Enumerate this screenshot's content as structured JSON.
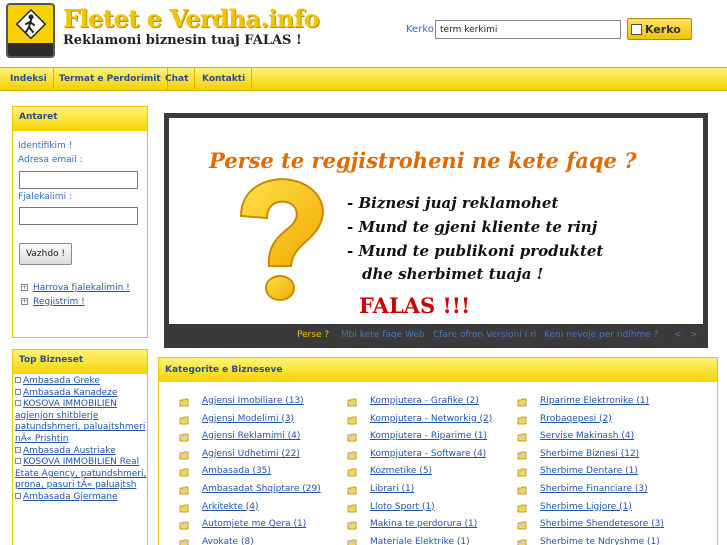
{
  "header": {
    "site_title": "Fletet e Verdha.info",
    "slogan": "Reklamoni biznesin tuaj FALAS !",
    "search_label": "Kerko",
    "search_value": "term kerkimi",
    "search_button": "Kerko"
  },
  "nav": {
    "items": [
      "Indeksi",
      "Termat e Perdorimit",
      "Chat",
      "Kontakti"
    ]
  },
  "members": {
    "title": "Antaret",
    "login_label": "Identifikim !",
    "email_label": "Adresa email :",
    "password_label": "Fjalekalimi :",
    "submit": "Vazhdo !",
    "forgot_link": "Harrova fjalekalimin !",
    "register_link": "Regjistrim !"
  },
  "top_business": {
    "title": "Top Bizneset",
    "items": [
      "Ambasada Greke",
      "Ambasada Kanadeze",
      "KOSOVA IMMOBILIEN agjenjon shitblerje patundshmeri, paluajtshmeri nÃ« Prishtin",
      "Ambasada Austriake",
      "KOSOVA IMMOBILIEN Real Etate Agency, patundshmeri, prona, pasuri tÃ« paluajtsh",
      "Ambasada Gjermane"
    ]
  },
  "banner": {
    "title": "Perse te regjistroheni ne kete faqe ?",
    "lines": [
      "- Biznesi juaj reklamohet",
      "- Mund te gjeni kliente te rinj",
      "- Mund te publikoni produktet",
      "dhe sherbimet tuaja !"
    ],
    "falas": "FALAS !!!",
    "tabs": [
      "Perse ?",
      "Mbi kete faqe Web",
      "Cfare ofron Versioni I ri",
      "Keni nevoje per ndihme ?"
    ],
    "prev": "<",
    "next": ">"
  },
  "categories": {
    "title": "Kategorite e Bizneseve",
    "col1": [
      "Agjensi Imobiliare (13)",
      "Agjensi Modelimi (3)",
      "Agjensi Reklamimi (4)",
      "Agjensi Udhetimi (22)",
      "Ambasada (35)",
      "Ambasadat Shqiptare (29)",
      "Arkitekte (4)",
      "Automjete me Qera (1)",
      "Avokate (8)"
    ],
    "col2": [
      "Kompjutera - Grafike (2)",
      "Kompjutera - Networkig (2)",
      "Kompjutera - Riparime (1)",
      "Kompjutera - Software (4)",
      "Kozmetike (5)",
      "Librari (1)",
      "Lloto Sport (1)",
      "Makina te perdorura (1)",
      "Materiale Elektrike (1)"
    ],
    "col3": [
      "Riparime Elektronike (1)",
      "Rrobaqepesi (2)",
      "Servise Makinash (4)",
      "Sherbime Biznesi (12)",
      "Sherbime Dentare (1)",
      "Sherbime Financiare (3)",
      "Sherbime Ligjore (1)",
      "Sherbime Shendetesore (3)",
      "Sherbime te Ndryshme (1)"
    ]
  },
  "colors": {
    "accent_yellow": "#f3d000",
    "link_blue": "#2255aa",
    "banner_orange": "#e06a00",
    "banner_red": "#cc0000"
  }
}
